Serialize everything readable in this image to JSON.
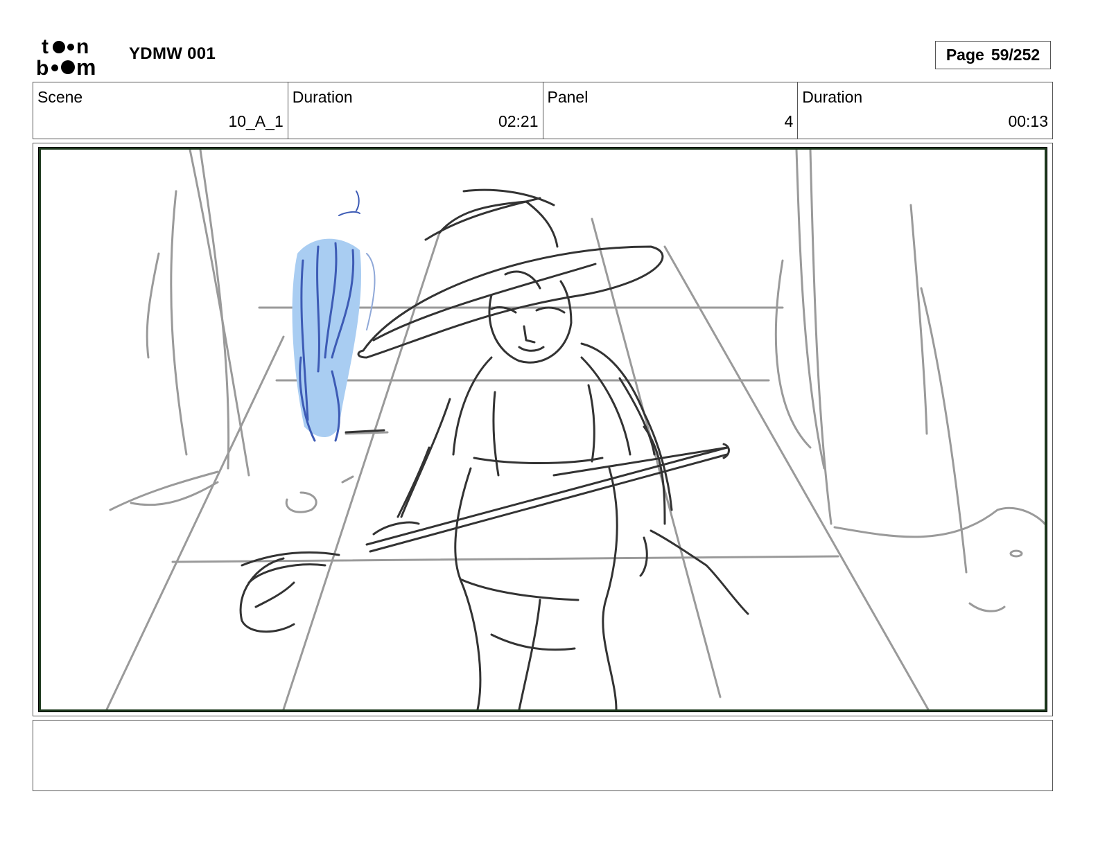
{
  "header": {
    "logo_top": "to●n",
    "logo_bottom": "b●●m",
    "project_title": "YDMW 001",
    "page_label": "Page",
    "page_value": "59/252"
  },
  "info": {
    "scene_label": "Scene",
    "scene_value": "10_A_1",
    "scene_duration_label": "Duration",
    "scene_duration_value": "02:21",
    "panel_label": "Panel",
    "panel_value": "4",
    "panel_duration_label": "Duration",
    "panel_duration_value": "00:13"
  },
  "panel": {
    "frame_color": "#1e3a1e",
    "sketch_color": "#333333",
    "background_line_color": "#9a9a9a",
    "spirit_color": "#6fa4e0"
  },
  "notes": {
    "text": ""
  }
}
